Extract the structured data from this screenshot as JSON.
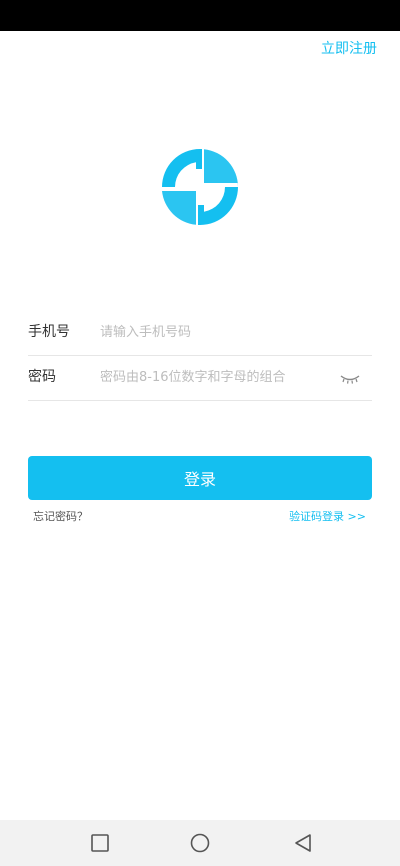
{
  "colors": {
    "accent": "#14bff0",
    "status_bar": "#000000",
    "nav_bar": "#f2f2f2"
  },
  "header": {
    "register_label": "立即注册"
  },
  "logo": {
    "icon": "app-logo-icon"
  },
  "form": {
    "phone": {
      "label": "手机号",
      "value": "",
      "placeholder": "请输入手机号码"
    },
    "password": {
      "label": "密码",
      "value": "",
      "placeholder": "密码由8-16位数字和字母的组合",
      "toggle_icon": "eye-closed-icon"
    }
  },
  "actions": {
    "login_label": "登录",
    "forgot_label": "忘记密码？",
    "code_login_label": "验证码登录 >>"
  },
  "navigation": {
    "recent_icon": "square-icon",
    "home_icon": "circle-icon",
    "back_icon": "triangle-back-icon"
  }
}
